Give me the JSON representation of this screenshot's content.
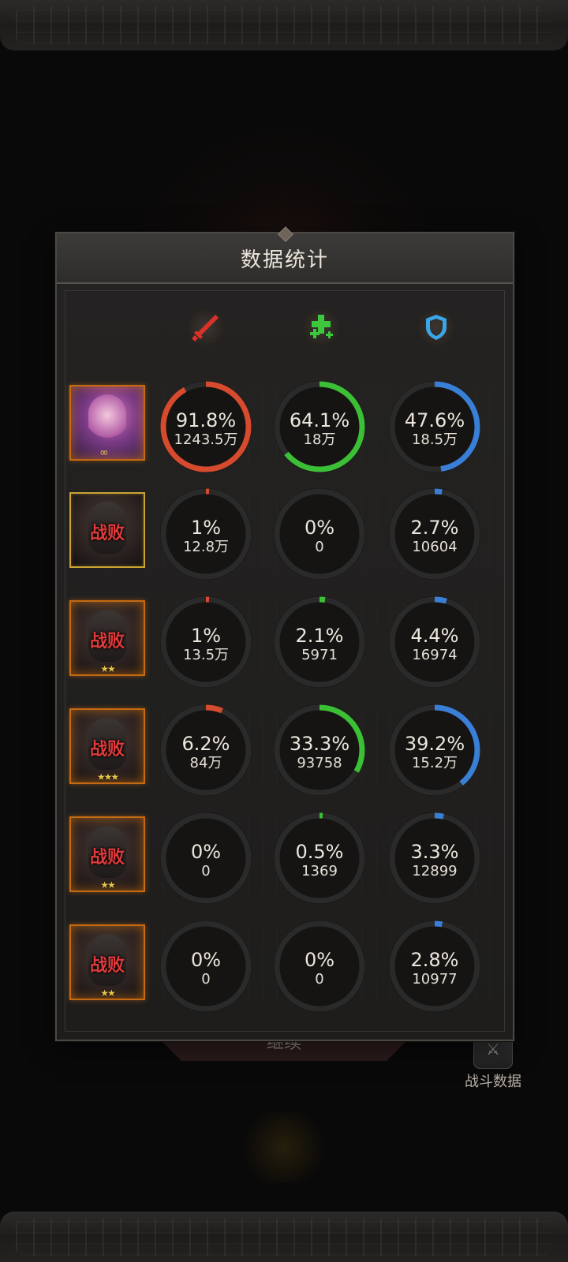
{
  "panel": {
    "title": "数据统计"
  },
  "stat_headers": [
    {
      "icon": "sword-icon",
      "color": "#d8322a"
    },
    {
      "icon": "heal-plus-icon",
      "color": "#3cc73c"
    },
    {
      "icon": "shield-icon",
      "color": "#3aa6e6"
    }
  ],
  "colors": {
    "damage": "#d64a2e",
    "heal": "#3bbf35",
    "shield": "#3a7fd6",
    "track": "#2a2a2a"
  },
  "heroes": [
    {
      "defeated": "",
      "stars": "",
      "stats": [
        {
          "percent": "91.8%",
          "value": "1243.5万",
          "fraction": 0.918
        },
        {
          "percent": "64.1%",
          "value": "18万",
          "fraction": 0.641
        },
        {
          "percent": "47.6%",
          "value": "18.5万",
          "fraction": 0.476
        }
      ]
    },
    {
      "defeated": "战败",
      "stars": "",
      "stats": [
        {
          "percent": "1%",
          "value": "12.8万",
          "fraction": 0.01
        },
        {
          "percent": "0%",
          "value": "0",
          "fraction": 0
        },
        {
          "percent": "2.7%",
          "value": "10604",
          "fraction": 0.027
        }
      ]
    },
    {
      "defeated": "战败",
      "stars": "★★",
      "stats": [
        {
          "percent": "1%",
          "value": "13.5万",
          "fraction": 0.01
        },
        {
          "percent": "2.1%",
          "value": "5971",
          "fraction": 0.021
        },
        {
          "percent": "4.4%",
          "value": "16974",
          "fraction": 0.044
        }
      ]
    },
    {
      "defeated": "战败",
      "stars": "★★★",
      "stats": [
        {
          "percent": "6.2%",
          "value": "84万",
          "fraction": 0.062
        },
        {
          "percent": "33.3%",
          "value": "93758",
          "fraction": 0.333
        },
        {
          "percent": "39.2%",
          "value": "15.2万",
          "fraction": 0.392
        }
      ]
    },
    {
      "defeated": "战败",
      "stars": "★★",
      "stats": [
        {
          "percent": "0%",
          "value": "0",
          "fraction": 0
        },
        {
          "percent": "0.5%",
          "value": "1369",
          "fraction": 0.005
        },
        {
          "percent": "3.3%",
          "value": "12899",
          "fraction": 0.033
        }
      ]
    },
    {
      "defeated": "战败",
      "stars": "★★",
      "stats": [
        {
          "percent": "0%",
          "value": "0",
          "fraction": 0
        },
        {
          "percent": "0%",
          "value": "0",
          "fraction": 0
        },
        {
          "percent": "2.8%",
          "value": "10977",
          "fraction": 0.028
        }
      ]
    }
  ],
  "footer": {
    "continue_label": "继续",
    "battle_data_label": "战斗数据"
  }
}
